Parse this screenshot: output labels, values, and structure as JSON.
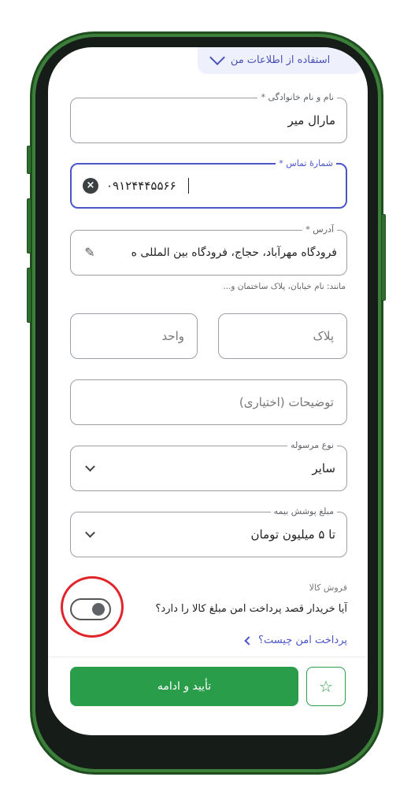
{
  "top_chip": {
    "text": "استفاده از اطلاعات من"
  },
  "fields": {
    "name": {
      "label": "نام و نام خانوادگی *",
      "value": "مارال میر"
    },
    "phone": {
      "label": "شمارهٔ تماس *",
      "value": "۰۹۱۲۴۴۴۵۵۶۶"
    },
    "address": {
      "label": "آدرس *",
      "value": "فرودگاه مهرآباد، حجاج، فرودگاه بین المللی ه",
      "helper": "مانند: نام خیابان، پلاک ساختمان و..."
    },
    "plaque": {
      "placeholder": "پلاک"
    },
    "unit": {
      "placeholder": "واحد"
    },
    "description": {
      "placeholder": "توضیحات (اختیاری)"
    },
    "shipment_type": {
      "label": "نوع مرسوله",
      "value": "سایر"
    },
    "insurance": {
      "label": "مبلغ پوشش بیمه",
      "value": "تا ۵ میلیون تومان"
    }
  },
  "sale": {
    "section_label": "فروش کالا",
    "question": "آیا خریدار قصد پرداخت امن مبلغ کالا را دارد؟",
    "link": "پرداخت امن چیست؟",
    "toggle_on": false
  },
  "actions": {
    "confirm_label": "تأیید و ادامه",
    "favorite_icon": "star-icon"
  },
  "colors": {
    "primary": "#2a9d4a",
    "accent": "#4b55c8",
    "highlight": "#e0252b",
    "frame": "#3b7f3a"
  }
}
